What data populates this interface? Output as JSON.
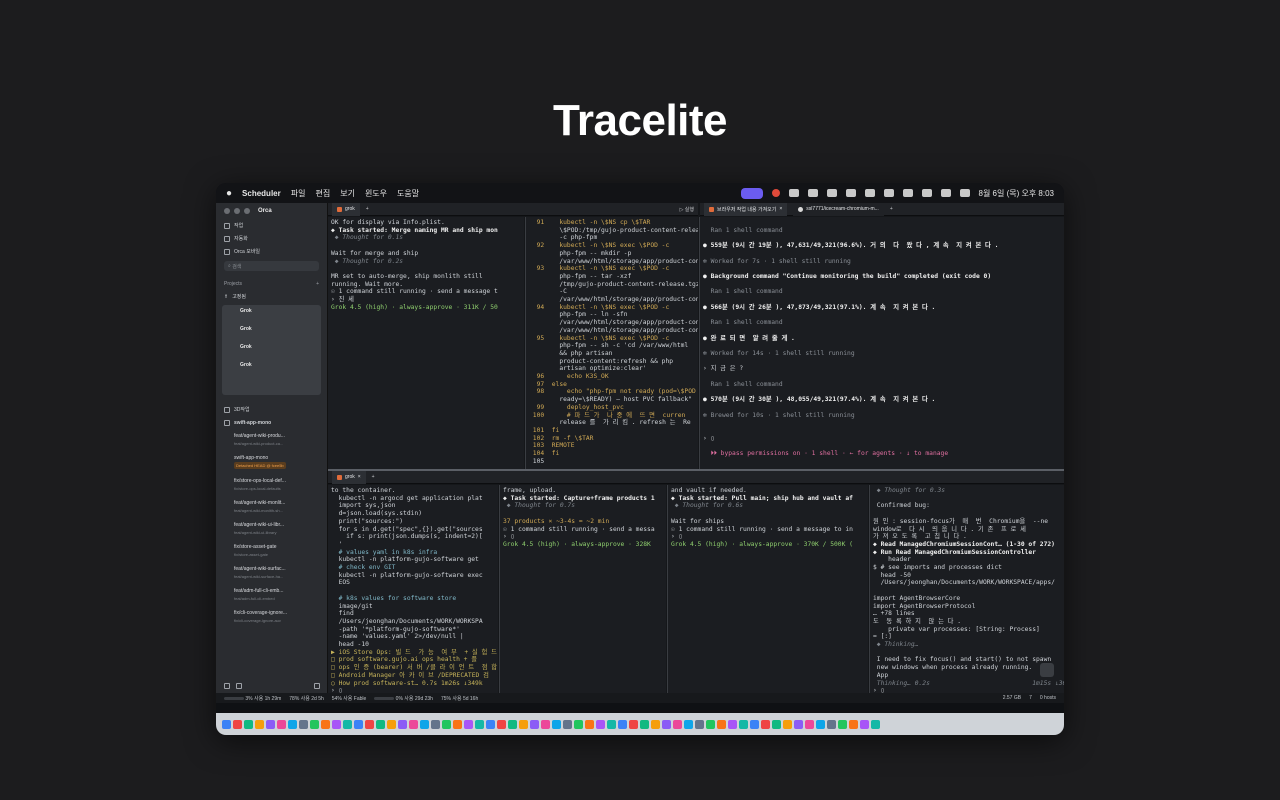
{
  "hero": {
    "title": "Tracelite"
  },
  "menubar": {
    "app_name": "Scheduler",
    "menus": [
      "파일",
      "편집",
      "보기",
      "윈도우",
      "도움말"
    ],
    "clock": "8월 6일 (목) 오후 8:03"
  },
  "sidebar": {
    "app_title": "Orca",
    "items": [
      {
        "label": "작업"
      },
      {
        "label": "자동화"
      },
      {
        "label": "Orca 모바일"
      }
    ],
    "search_placeholder": "검색",
    "projects_label": "Projects",
    "pinned_label": "고정됨",
    "pinned_items": [
      {
        "label": "Grok",
        "sub": ""
      },
      {
        "label": "Grok",
        "sub": ""
      },
      {
        "label": "Grok",
        "sub": ""
      },
      {
        "label": "Grok",
        "sub": ""
      }
    ],
    "group_label": "3D작업",
    "repo_label": "swift-app-mono",
    "worktrees": [
      {
        "name": "feat/agent-wiki-produ...",
        "branch": "feat/agent-wiki-product-ca..."
      },
      {
        "name": "swift-app-mono",
        "branch": "",
        "badge": "Detached HEAD @ fcee5b"
      },
      {
        "name": "fix/store-ops-local-def...",
        "branch": "fix/store-ops-local-defaults"
      },
      {
        "name": "feat/agent-wiki-monlit...",
        "branch": "feat/agent-wiki-monlith-sh..."
      },
      {
        "name": "feat/agent-wiki-ui-libr...",
        "branch": "feat/agent-wiki-ui-library"
      },
      {
        "name": "fix/store-asset-gate",
        "branch": "fix/store-asset-gate"
      },
      {
        "name": "feat/agent-wiki-surfac...",
        "branch": "feat/agent-wiki-surface-ha..."
      },
      {
        "name": "feat/adm-full-cli-emb...",
        "branch": "feat/adm-full-cli-embed"
      },
      {
        "name": "fix/cli-coverage-ignore...",
        "branch": "fix/cli-coverage-ignore-auv"
      }
    ]
  },
  "tabs_top": {
    "left_tab": "grok",
    "right_tab_1": "브라우저 작업 내용 가져오기",
    "right_tab_2": "ssl7771/icecream-chromium-m...",
    "run_label": "실행"
  },
  "tabs_bottom": {
    "left_tab": "grok"
  },
  "pane_a": {
    "lines": [
      "OK for display via Info.plist.",
      "◆ Task started: Merge naming MR and ship mon",
      " ◆ Thought for 0.1s",
      "",
      "Wait for merge and ship",
      " ◆ Thought for 0.2s",
      "",
      "MR set to auto-merge, ship monlith still",
      "running. Wait more.",
      "☉ 1 command still running · send a message t",
      "› 진 세",
      "Grok 4.5 (high) · always-approve · 311K / 50"
    ]
  },
  "pane_b": {
    "lines": [
      "  91    kubectl -n \\$NS cp \\$TAR",
      "        \\$POD:/tmp/gujo-product-content-relea",
      "        -c php-fpm",
      "  92    kubectl -n \\$NS exec \\$POD -c",
      "        php-fpm -- mkdir -p",
      "        /var/www/html/storage/app/product-con",
      "  93    kubectl -n \\$NS exec \\$POD -c",
      "        php-fpm -- tar -xzf",
      "        /tmp/gujo-product-content-release.tgz",
      "        -C",
      "        /var/www/html/storage/app/product-con",
      "  94    kubectl -n \\$NS exec \\$POD -c",
      "        php-fpm -- ln -sfn",
      "        /var/www/html/storage/app/product-con",
      "        /var/www/html/storage/app/product-con",
      "  95    kubectl -n \\$NS exec \\$POD -c",
      "        php-fpm -- sh -c 'cd /var/www/html",
      "        && php artisan",
      "        product-content:refresh && php",
      "        artisan optimize:clear'",
      "  96      echo K3S_OK",
      "  97  else",
      "  98      echo \"php-fpm not ready (pod=\\$POD",
      "        ready=\\$READY) — host PVC fallback\"",
      "  99      deploy_host_pvc",
      " 100      # 파 드 가  나 중 에  뜨 면  curren",
      "        release 를  가 리 킴 . refresh 는  Re",
      " 101  fi",
      " 102  rm -f \\$TAR",
      " 103  REMOTE",
      " 104  fi",
      " 105"
    ]
  },
  "pane_c": {
    "lines": [
      "",
      "  Ran 1 shell command",
      "",
      "● 559분 (9시 간 19분 ), 47,631/49,321(96.6%). 거 의  다  왔 다 , 계 속  지 켜 본 다 .",
      "",
      "✻ Worked for 7s · 1 shell still running",
      "",
      "● Background command \"Continue monitoring the build\" completed (exit code 0)",
      "",
      "  Ran 1 shell command",
      "",
      "● 566분 (9시 간 26분 ), 47,873/49,321(97.1%). 계 속  지 켜 본 다 .",
      "",
      "  Ran 1 shell command",
      "",
      "● 완 료 되 면  알 려 줄 게 .",
      "",
      "✻ Worked for 14s · 1 shell still running",
      "",
      "› 지 금 은 ?",
      "",
      "  Ran 1 shell command",
      "",
      "● 570분 (9시 간 30분 ), 48,055/49,321(97.4%). 계 속  지 켜 본 다 .",
      "",
      "✻ Brewed for 10s · 1 shell still running",
      "",
      "",
      "› ▯",
      "",
      "  ⏵⏵ bypass permissions on · 1 shell · ← for agents · ↓ to manage"
    ]
  },
  "pane_d": {
    "lines": [
      "to the container.",
      "  kubectl -n argocd get application plat",
      "  import sys,json",
      "  d=json.load(sys.stdin)",
      "  print(\"sources:\")",
      "  for s in d.get(\"spec\",{}).get(\"sources",
      "    if s: print(json.dumps(s, indent=2)[",
      "  '",
      "  # values yaml in k8s infra",
      "  kubectl -n platform-gujo-software get",
      "  # check env GIT",
      "  kubectl -n platform-gujo-software exec",
      "  EOS",
      "",
      "  # k8s values for software store",
      "  image/git",
      "  find",
      "  /Users/jeonghan/Documents/WORK/WORKSPA",
      "  -path '*platform-gujo-software*'",
      "  -name 'values.yaml' 2>/dev/null |",
      "  head -10",
      "▶ iOS Store Ops: 빌 드  가 능  여 부  + 실 험 드",
      "□ prod software.gujo.ai ops health + 플",
      "□ ops 인 증 (bearer) 서 버 /클 라 이 언 트  점 합",
      "□ Android Manager 아 카 이 브 /DEPRECATED 검",
      "○ How prod software-st… 0.7s 1m26s ↓349k",
      "› ▯",
      "Grok 4.5 (high) · always-approve · 349K"
    ]
  },
  "pane_e": {
    "lines": [
      "frame, upload.",
      "◆ Task started: Capture+frame products 1",
      " ◆ Thought for 0.7s",
      "",
      "37 products × ~3-4s = ~2 min",
      "☉ 1 command still running · send a messa",
      "› ▯",
      "Grok 4.5 (high) · always-approve · 328K"
    ]
  },
  "pane_f": {
    "lines": [
      "and vault if needed.",
      "◆ Task started: Pull main; ship hub and vault af",
      " ◆ Thought for 0.6s",
      "",
      "Wait for ships",
      "☉ 1 command still running · send a message to in",
      "› ▯",
      "Grok 4.5 (high) · always-approve · 370K / 500K ("
    ]
  },
  "pane_g": {
    "lines": [
      " ◆ Thought for 0.3s",
      "",
      " Confirmed bug:",
      "",
      "원 인 : session-focus가  매  번  Chromium을  --ne",
      "window로  다 시  띄 웁 니 다 . 기 존  프 로 세",
      "가 져 오 도 록  고 칩 니 다 .",
      "◆ Read ManagedChromiumSessionCont… (1-30 of 272)",
      "◆ Run Read ManagedChromiumSessionController",
      "    header",
      "$ # see imports and processes dict",
      "  head -50",
      "  /Users/jeonghan/Documents/WORK/WORKSPACE/apps/",
      "",
      "import AgentBrowserCore",
      "import AgentBrowserProtocol",
      "… +78 lines",
      "도  동 록 하 지  않 는 다 .",
      "    private var processes: [String: Process]",
      "= [:]",
      " ◆ Thinking…",
      "",
      " I need to fix focus() and start() to not spawn",
      " new windows when process already running.",
      " App",
      " Thinking… 0.2s                           1m15s ↓364k",
      "› ▯",
      "Grok 4.5 (high) · always-approve · 364K / 500K ("
    ]
  },
  "statusbar": {
    "items": [
      "3% 사용 1h 29m",
      "78% 사용 2d 5h",
      "54% 사용 Fable",
      "0% 사용 29d 23h",
      "75% 사용 5d 16h"
    ],
    "right": [
      "2.57 GB",
      "7",
      "0 hosts"
    ]
  },
  "colors": {
    "accent": "#6b5cf0",
    "warning": "#f0a04b",
    "green": "#8fcf6e"
  }
}
